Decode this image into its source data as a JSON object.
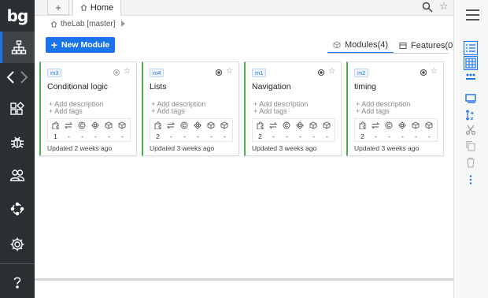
{
  "app": {
    "logo_text": "bg",
    "accent_color": "#1a73e8",
    "sidebar_bg": "#2b2f33"
  },
  "sidebar": {
    "items": [
      {
        "name": "hierarchy-icon",
        "active": true
      },
      {
        "name": "nav-back-icon"
      },
      {
        "name": "nav-forward-icon"
      },
      {
        "name": "shapes-icon"
      },
      {
        "name": "bug-icon"
      },
      {
        "name": "users-icon"
      },
      {
        "name": "loop-icon"
      },
      {
        "name": "settings-icon"
      },
      {
        "name": "help-icon"
      }
    ],
    "help_label": "?"
  },
  "tabs": {
    "plus_label": "+",
    "home_label": "Home"
  },
  "breadcrumb": {
    "text": "theLab [master]"
  },
  "toolbar": {
    "new_module_label": "New Module",
    "new_module_plus": "+"
  },
  "view_tabs": [
    {
      "label": "Modules(4)",
      "active": true,
      "icon": "cube-icon"
    },
    {
      "label": "Features(0)",
      "active": false,
      "icon": "feature-icon"
    }
  ],
  "star_glyph": "☆",
  "cards": [
    {
      "id": "m3",
      "title": "Conditional logic",
      "add_description": "+ Add description",
      "add_tags": "+ Add tags",
      "metrics": [
        "1",
        "-",
        "-",
        "-",
        "-",
        "-"
      ],
      "updated": "Updated 2 weeks ago"
    },
    {
      "id": "m4",
      "title": "Lists",
      "add_description": "+ Add description",
      "add_tags": "+ Add tags",
      "metrics": [
        "2",
        "-",
        "-",
        "-",
        "-",
        "-"
      ],
      "updated": "Updated 3 weeks ago"
    },
    {
      "id": "m1",
      "title": "Navigation",
      "add_description": "+ Add description",
      "add_tags": "+ Add tags",
      "metrics": [
        "2",
        "-",
        "-",
        "-",
        "-",
        "-"
      ],
      "updated": "Updated 3 weeks ago"
    },
    {
      "id": "m2",
      "title": "timing",
      "add_description": "+ Add description",
      "add_tags": "+ Add tags",
      "metrics": [
        "2",
        "-",
        "-",
        "-",
        "-",
        "-"
      ],
      "updated": "Updated 3 weeks ago"
    }
  ],
  "metric_icons": [
    "puzzle-icon",
    "swap-icon",
    "copyright-icon",
    "gear-diamond-icon",
    "box-icon",
    "cube-icon"
  ],
  "right_panel": {
    "items": [
      "list-view-icon",
      "grid-view-icon",
      "dots-view-icon",
      "panel-icon",
      "sort-az-icon",
      "cut-icon",
      "copy-icon",
      "trash-icon",
      "more-vertical-icon"
    ]
  }
}
